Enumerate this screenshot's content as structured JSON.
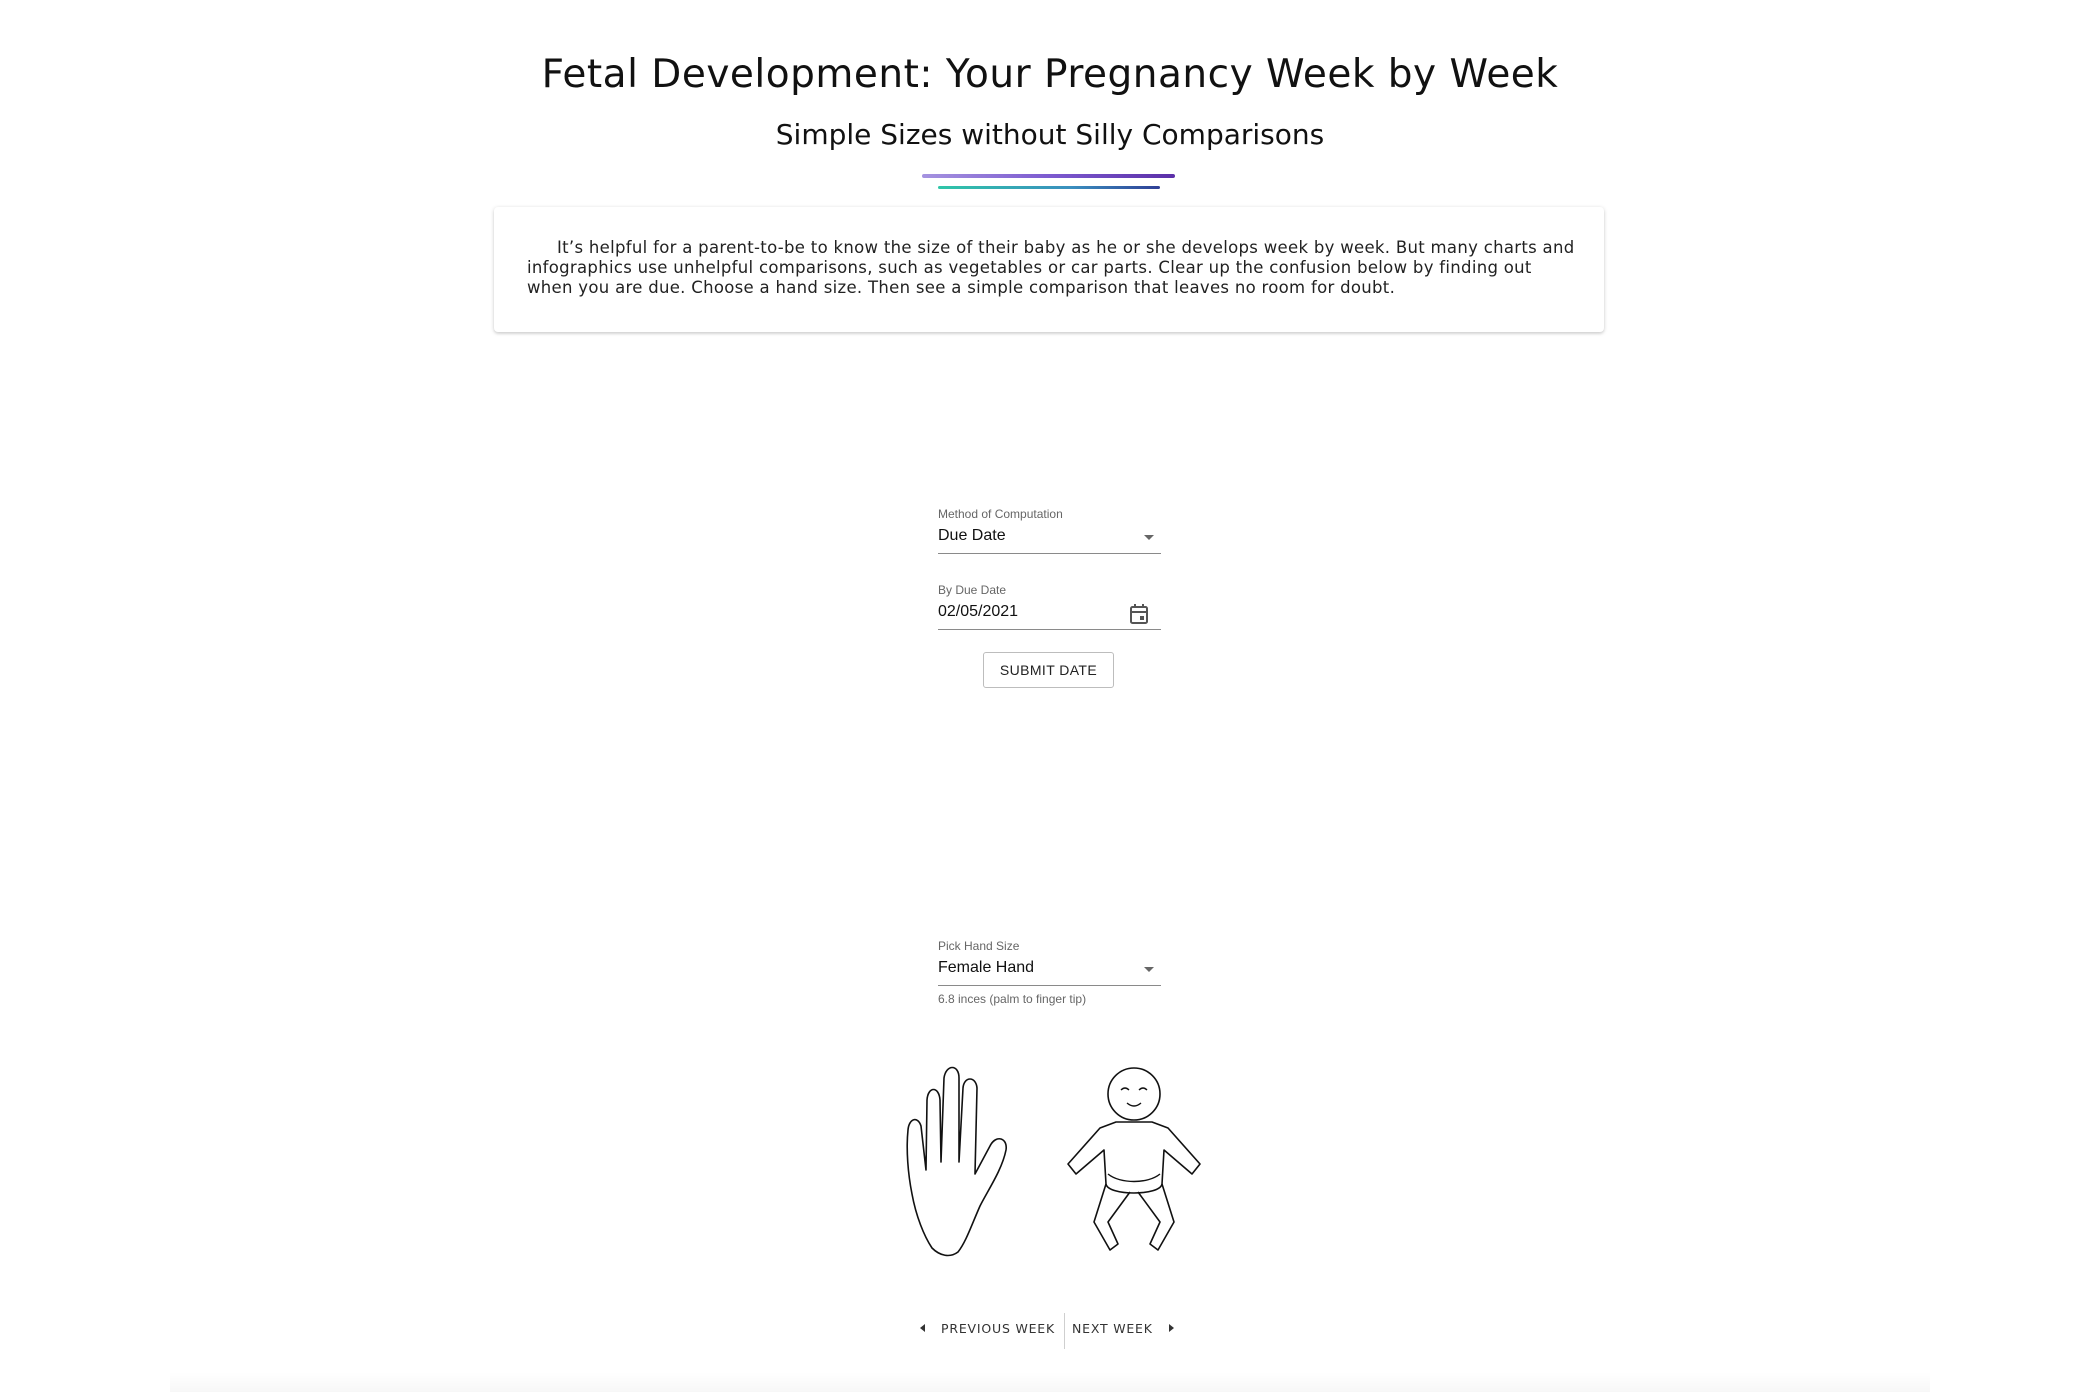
{
  "header": {
    "title": "Fetal Development: Your Pregnancy Week by Week",
    "subtitle": "Simple Sizes without Silly Comparisons"
  },
  "intro": {
    "text": "It’s helpful for a parent-to-be to know the size of their baby as he or she develops week by week. But many charts and infographics use unhelpful comparisons, such as vegetables or car parts. Clear up the confusion below by finding out when you are due. Choose a hand size. Then see a simple comparison that leaves no room for doubt."
  },
  "form": {
    "method": {
      "label": "Method of Computation",
      "value": "Due Date"
    },
    "due_date": {
      "label": "By Due Date",
      "value": "02/05/2021"
    },
    "submit_label": "SUBMIT DATE"
  },
  "hand_size": {
    "label": "Pick Hand Size",
    "value": "Female Hand",
    "helper": "6.8 inces (palm to finger tip)"
  },
  "illustrations": {
    "hand_icon": "hand-outline-icon",
    "baby_icon": "baby-outline-icon"
  },
  "nav": {
    "prev_label": "PREVIOUS WEEK",
    "next_label": "NEXT WEEK"
  },
  "colors": {
    "rule_purple": "#7d5bd0",
    "rule_teal": "#2fc6a8"
  }
}
